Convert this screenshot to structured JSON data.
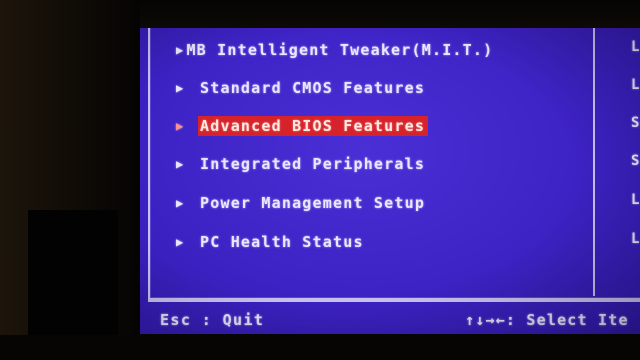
{
  "menu": {
    "items": [
      {
        "label": "MB Intelligent Tweaker(M.I.T.)",
        "selected": false
      },
      {
        "label": "Standard CMOS Features",
        "selected": false
      },
      {
        "label": "Advanced BIOS Features",
        "selected": true
      },
      {
        "label": "Integrated Peripherals",
        "selected": false
      },
      {
        "label": "Power Management Setup",
        "selected": false
      },
      {
        "label": "PC Health Status",
        "selected": false
      }
    ],
    "arrow_glyph": "▶"
  },
  "right_column": {
    "letters": [
      "L",
      "L",
      "S",
      "S",
      "L",
      "L"
    ]
  },
  "footer": {
    "left": "Esc : Quit",
    "right": "↑↓→←: Select Ite"
  },
  "colors": {
    "background": "#3d22c4",
    "text": "#e9e6ff",
    "highlight": "#d6222a",
    "frame": "#c9c2ef"
  }
}
